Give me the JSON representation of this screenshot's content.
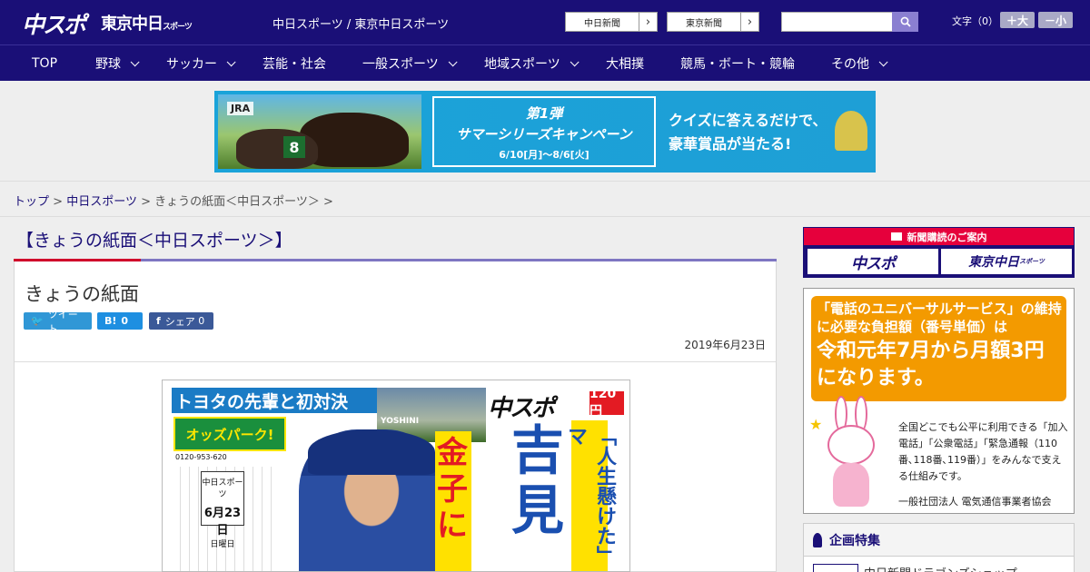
{
  "header": {
    "logo_primary": "中スポ",
    "logo_secondary": "東京中日",
    "logo_secondary_small": "スポーツ",
    "caption": "中日スポーツ / 東京中日スポーツ",
    "site_links": [
      {
        "label": "中日新聞"
      },
      {
        "label": "東京新聞"
      }
    ],
    "search_placeholder": "",
    "font_size_label": "文字（0）",
    "font_larger": "＋大",
    "font_smaller": "－小"
  },
  "nav": {
    "items": [
      {
        "label": "TOP",
        "dropdown": false
      },
      {
        "label": "野球",
        "dropdown": true
      },
      {
        "label": "サッカー",
        "dropdown": true
      },
      {
        "label": "芸能・社会",
        "dropdown": false
      },
      {
        "label": "一般スポーツ",
        "dropdown": true
      },
      {
        "label": "地域スポーツ",
        "dropdown": true
      },
      {
        "label": "大相撲",
        "dropdown": false
      },
      {
        "label": "競馬・ボート・競輪",
        "dropdown": false
      },
      {
        "label": "その他",
        "dropdown": true
      }
    ]
  },
  "banner": {
    "brand": "JRA",
    "horse_number": "8",
    "campaign_line1": "第1弾",
    "campaign_line2": "サマーシリーズキャンペーン",
    "campaign_dates": "6/10[月]～8/6[火]",
    "quiz_line1": "クイズに答えるだけで、",
    "quiz_line2": "豪華賞品が当たる!"
  },
  "breadcrumb": {
    "home": "トップ",
    "section": "中日スポーツ",
    "current": "きょうの紙面＜中日スポーツ＞",
    "separator": ">"
  },
  "main": {
    "heading": "【きょうの紙面＜中日スポーツ＞】",
    "title": "きょうの紙面",
    "share": {
      "tweet": "ツイート",
      "hatena_icon": "B!",
      "hatena_count": "0",
      "facebook_label": "シェア",
      "facebook_count": "0"
    },
    "date": "2019年6月23日",
    "paper": {
      "headline": "トヨタの先輩と初対決",
      "logo": "中スポ",
      "price": "120円",
      "ad": "オッズパーク!",
      "tel": "0120-953-620",
      "date_top": "中日スポーツ",
      "date_main": "6月23日",
      "date_day": "日曜日",
      "player_name_tag": "YOSHINI",
      "big_red": "金子に",
      "big_blue": "吉見",
      "slogan": "「人生懸けた」マ"
    }
  },
  "sidebar": {
    "subscribe_heading": "新聞購読のご案内",
    "subscribe_primary": "中スポ",
    "subscribe_secondary": "東京中日",
    "subscribe_secondary_small": "スポーツ",
    "ad": {
      "line1": "「電話のユニバーサルサービス」の維持に必要な負担額（番号単価）は",
      "line2": "令和元年7月から月額3円になります。",
      "desc": "全国どこでも公平に利用できる「加入電話」「公衆電話」「緊急通報（110番､118番､119番）」をみんなで支える仕組みです。",
      "org": "一般社団法人 電気通信事業者協会"
    },
    "feature_heading": "企画特集",
    "feature_item": "中日新聞ドラゴンズショップ"
  },
  "colors": {
    "brand_navy": "#1a0f77",
    "accent_red": "#d0002a",
    "accent_purple": "#7e76c2"
  }
}
